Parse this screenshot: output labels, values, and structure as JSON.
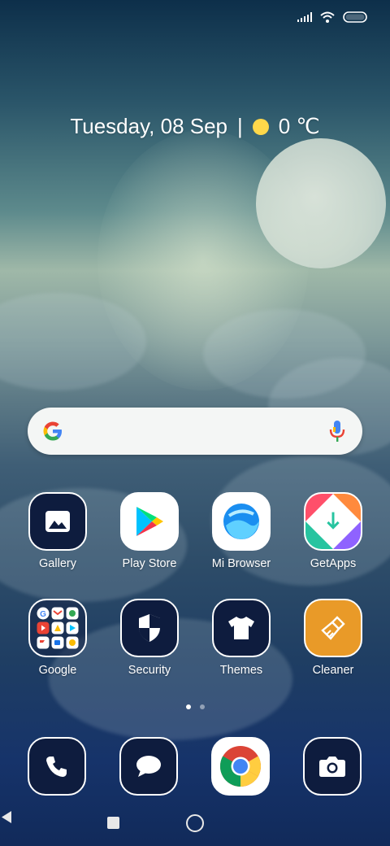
{
  "status_bar": {
    "icons": [
      "signal-icon",
      "wifi-icon",
      "battery-icon"
    ]
  },
  "home": {
    "date": "Tuesday, 08 Sep",
    "separator": "|",
    "temperature": "0 ℃",
    "weather_icon": "sun-icon"
  },
  "search": {
    "icon_left": "google-g-icon",
    "icon_right": "microphone-icon"
  },
  "apps_row1": [
    {
      "label": "Gallery",
      "icon": "gallery-icon"
    },
    {
      "label": "Play Store",
      "icon": "play-store-icon"
    },
    {
      "label": "Mi Browser",
      "icon": "mi-browser-icon"
    },
    {
      "label": "GetApps",
      "icon": "getapps-icon"
    }
  ],
  "apps_row2": [
    {
      "label": "Google",
      "icon": "google-folder-icon"
    },
    {
      "label": "Security",
      "icon": "security-shield-icon"
    },
    {
      "label": "Themes",
      "icon": "tshirt-icon"
    },
    {
      "label": "Cleaner",
      "icon": "broom-icon"
    }
  ],
  "page_indicator": {
    "count": 2,
    "active": 1
  },
  "dock": [
    "phone-icon",
    "messages-icon",
    "chrome-icon",
    "camera-icon"
  ],
  "nav": [
    "recents-icon",
    "home-icon",
    "back-icon"
  ],
  "colors": {
    "tile_dark": "#0e1c3e",
    "cleaner_orange": "#e99a28",
    "sun_yellow": "#ffd84a"
  }
}
